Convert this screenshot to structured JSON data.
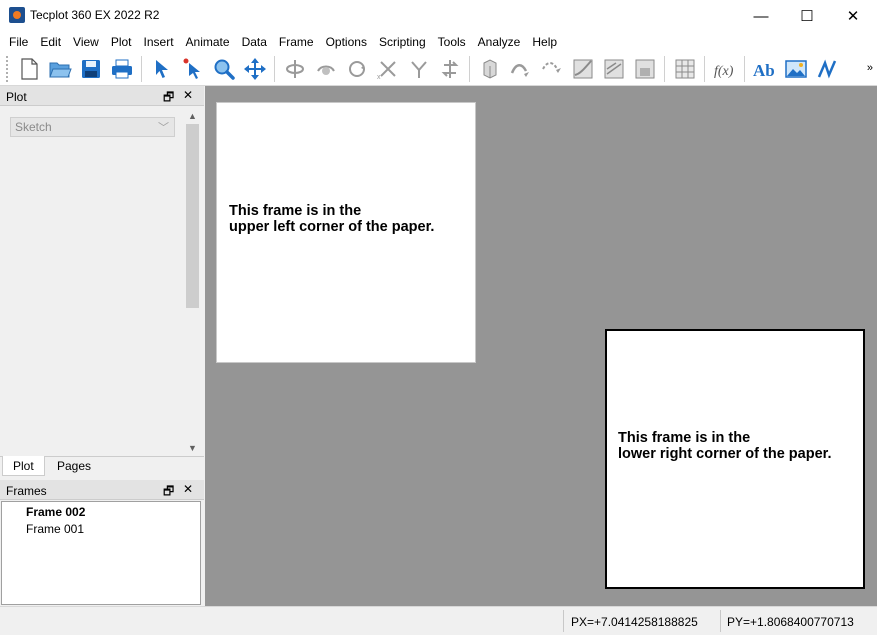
{
  "window": {
    "title": "Tecplot 360 EX 2022 R2",
    "controls": {
      "minimize": "—",
      "maximize": "☐",
      "close": "✕"
    }
  },
  "menubar": [
    "File",
    "Edit",
    "View",
    "Plot",
    "Insert",
    "Animate",
    "Data",
    "Frame",
    "Options",
    "Scripting",
    "Tools",
    "Analyze",
    "Help"
  ],
  "toolbar": {
    "more": "»",
    "buttons": [
      "new-layout",
      "open-layout",
      "save-layout",
      "print",
      "selector",
      "adjustor",
      "zoom",
      "translate",
      "rotate",
      "rollerball-rotate",
      "spherical-rotate",
      "x-axis-rotate",
      "y-axis-rotate",
      "twist-rotate",
      "probe",
      "extract-streamtrace",
      "slice",
      "contour-levels",
      "isosurface",
      "blanking",
      "iso-values",
      "3d-grid",
      "formula",
      "text",
      "image",
      "polyline"
    ]
  },
  "plot_panel": {
    "title": "Plot",
    "plot_type": "Sketch",
    "tabs": [
      "Plot",
      "Pages"
    ],
    "active_tab": "Plot"
  },
  "frames_panel": {
    "title": "Frames",
    "frames": [
      {
        "name": "Frame 002",
        "active": true
      },
      {
        "name": "Frame 001",
        "active": false
      }
    ]
  },
  "workspace": {
    "frames": [
      {
        "id": "frame-001",
        "text_line1": "This frame is in the",
        "text_line2": "upper left corner of the paper."
      },
      {
        "id": "frame-002",
        "text_line1": "This frame is in the",
        "text_line2": "lower right corner of the paper."
      }
    ]
  },
  "statusbar": {
    "px": "PX=+7.0414258188825",
    "py": "PY=+1.8068400770713"
  },
  "colors": {
    "workspace_bg": "#959595",
    "paper": "#ffffff",
    "accent": "#1f6fc5"
  }
}
